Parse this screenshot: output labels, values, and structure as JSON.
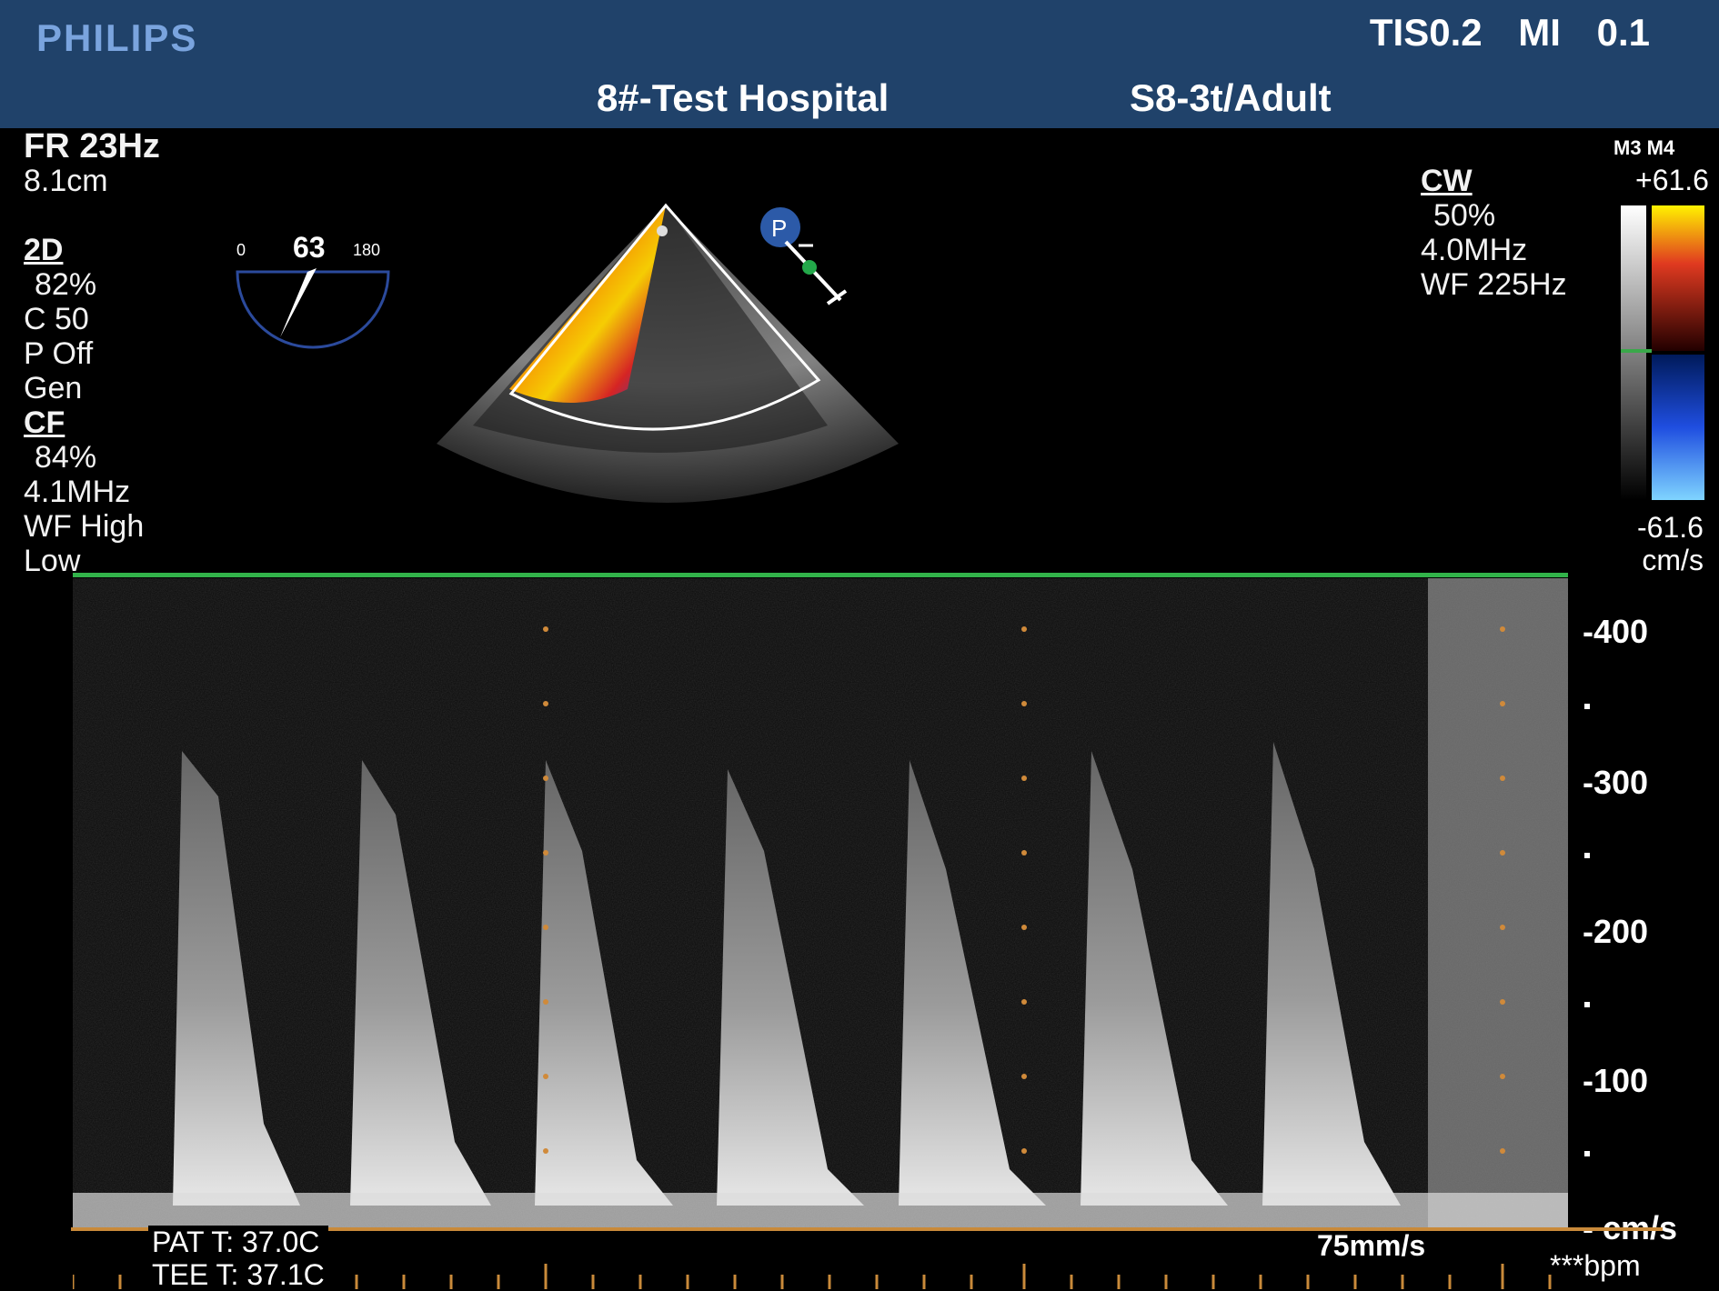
{
  "header": {
    "brand": "PHILIPS",
    "safety": "TIS0.2 MI 0.1",
    "hospital": "8#-Test Hospital",
    "probe": "S8-3t/Adult"
  },
  "left_params": {
    "frame_rate": "FR 23Hz",
    "depth": "8.1cm",
    "mode_2d": "2D",
    "gain_2d": "82%",
    "compression": "C 50",
    "persistence": "P Off",
    "gen": "Gen",
    "mode_cf": "CF",
    "gain_cf": "84%",
    "freq_cf": "4.1MHz",
    "wall_filter": "WF High",
    "priority": "Low"
  },
  "angle_indicator": {
    "min": "0",
    "value": "63",
    "max": "180"
  },
  "doppler_params": {
    "mode": "CW",
    "gain": "50%",
    "freq": "4.0MHz",
    "wall_filter": "WF 225Hz"
  },
  "color_scale": {
    "map_labels": "M3 M4",
    "top": "+61.6",
    "bottom": "-61.6",
    "unit": "cm/s"
  },
  "velocity_scale": {
    "labels": [
      "-400",
      "-300",
      "-200",
      "-100"
    ],
    "unit": "- cm/s",
    "values": [
      400,
      300,
      200,
      100
    ]
  },
  "footer": {
    "pat_temp": "PAT T: 37.0C",
    "tee_temp": "TEE T: 37.1C",
    "sweep_speed": "75mm/s",
    "heart_rate": "***bpm"
  },
  "colors": {
    "header_bg": "#20426a",
    "brand": "#7aa4de",
    "trace_line": "#32b34a",
    "baseline": "#c98a3a"
  }
}
